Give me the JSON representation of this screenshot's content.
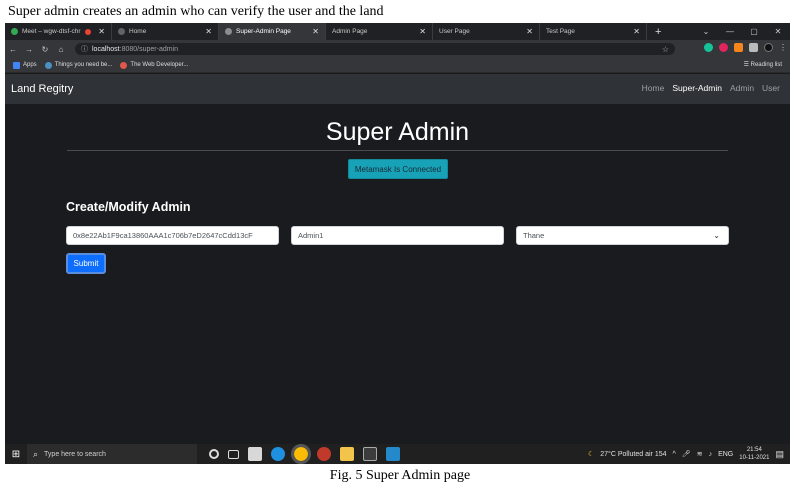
{
  "caption_top": "Super admin creates an admin who can verify the user and the land",
  "caption_bottom": "Fig. 5 Super Admin page",
  "browser": {
    "tabs": [
      {
        "label": "Meet – wgw-dtsf-chr",
        "icon": "meet-icon",
        "color": "#34a853"
      },
      {
        "label": "Home",
        "icon": "page-icon",
        "color": "#5f6368"
      },
      {
        "label": "Super-Admin Page",
        "icon": "page-icon",
        "color": "#5f6368",
        "active": true
      },
      {
        "label": "Admin Page",
        "icon": "page-icon",
        "color": "#5f6368"
      },
      {
        "label": "User Page",
        "icon": "page-icon",
        "color": "#5f6368"
      },
      {
        "label": "Test Page",
        "icon": "page-icon",
        "color": "#5f6368"
      }
    ],
    "url_host": "localhost",
    "url_path": ":8080/super-admin",
    "bookmarks": [
      "Apps",
      "Things you need be...",
      "The Web Developer..."
    ],
    "reading_list": "Reading list"
  },
  "app": {
    "brand": "Land Regitry",
    "nav": [
      "Home",
      "Super-Admin",
      "Admin",
      "User"
    ],
    "nav_active": "Super-Admin",
    "page_title": "Super Admin",
    "metamask_status": "Metamask Is Connected",
    "form_title": "Create/Modify Admin",
    "address_value": "0x8e22Ab1F9ca13860AAA1c706b7eD2647cCdd13cF",
    "name_value": "Admin1",
    "city_value": "Thane",
    "submit_label": "Submit",
    "accent_color": "#17a2b8",
    "primary_color": "#0d6efd"
  },
  "taskbar": {
    "search_placeholder": "Type here to search",
    "weather": "27°C  Polluted air 154",
    "language": "ENG",
    "time": "21:54",
    "date": "10-11-2021"
  }
}
